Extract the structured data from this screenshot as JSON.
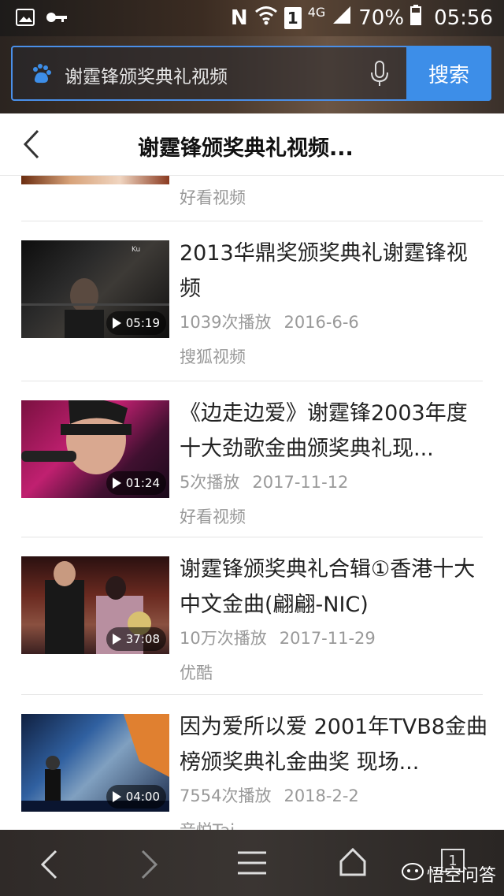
{
  "status_bar": {
    "network": "4G",
    "sim": "1",
    "battery": "70%",
    "time": "05:56",
    "icons": [
      "image-icon",
      "key-icon",
      "nfc-icon",
      "wifi-icon",
      "sim-icon",
      "signal-icon",
      "battery-icon"
    ]
  },
  "search": {
    "query": "谢霆锋颁奖典礼视频",
    "button_label": "搜索",
    "colors": {
      "accent": "#3d8ee8"
    }
  },
  "header": {
    "title": "谢霆锋颁奖典礼视频..."
  },
  "partial_item": {
    "source": "好看视频"
  },
  "videos": [
    {
      "title": "2013华鼎奖颁奖典礼谢霆锋视频",
      "duration": "05:19",
      "plays": "1039次播放",
      "date": "2016-6-6",
      "source": "搜狐视频"
    },
    {
      "title": "《边走边爱》谢霆锋2003年度十大劲歌金曲颁奖典礼现...",
      "duration": "01:24",
      "plays": "5次播放",
      "date": "2017-11-12",
      "source": "好看视频"
    },
    {
      "title": "谢霆锋颁奖典礼合辑①香港十大中文金曲(翩翩-NIC)",
      "duration": "37:08",
      "plays": "10万次播放",
      "date": "2017-11-29",
      "source": "优酷"
    },
    {
      "title": "因为爱所以爱 2001年TVB8金曲榜颁奖典礼金曲奖 现场...",
      "duration": "04:00",
      "plays": "7554次播放",
      "date": "2018-2-2",
      "source": "音悦Tai"
    }
  ],
  "bottom_nav": {
    "tab_count": "1",
    "watermark": "悟空问答"
  }
}
